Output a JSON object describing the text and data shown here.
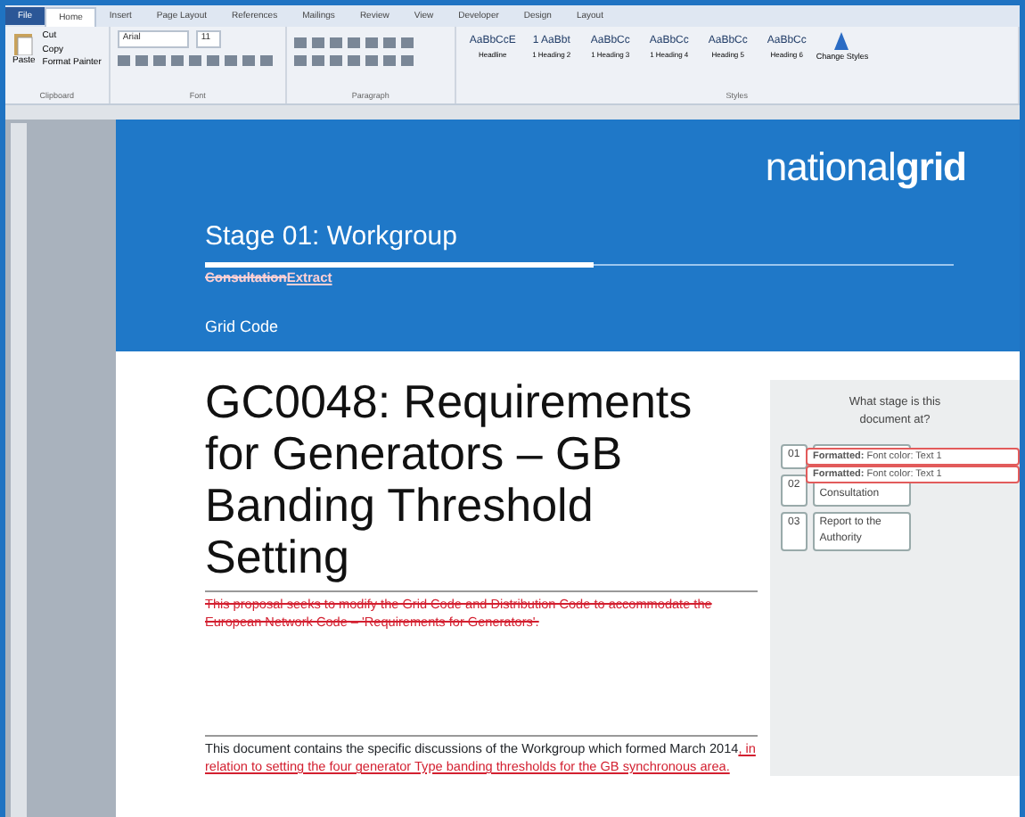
{
  "ribbon": {
    "tabs": [
      {
        "label": "File",
        "selected": false,
        "kind": "file"
      },
      {
        "label": "Home",
        "selected": true
      },
      {
        "label": "Insert",
        "selected": false
      },
      {
        "label": "Page Layout",
        "selected": false
      },
      {
        "label": "References",
        "selected": false
      },
      {
        "label": "Mailings",
        "selected": false
      },
      {
        "label": "Review",
        "selected": false
      },
      {
        "label": "View",
        "selected": false
      },
      {
        "label": "Developer",
        "selected": false
      },
      {
        "label": "Design",
        "selected": false
      },
      {
        "label": "Layout",
        "selected": false
      }
    ],
    "clipboard": {
      "paste": "Paste",
      "items": [
        "Cut",
        "Copy",
        "Format Painter"
      ],
      "label": "Clipboard"
    },
    "font": {
      "name": "Arial",
      "size": "11",
      "label": "Font"
    },
    "paragraph": {
      "label": "Paragraph"
    },
    "styles": {
      "label": "Styles",
      "items": [
        {
          "preview": "AaBbCcE",
          "name": "Headline"
        },
        {
          "preview": "1 AaBbt",
          "name": "1 Heading 2"
        },
        {
          "preview": "AaBbCc",
          "name": "1 Heading 3"
        },
        {
          "preview": "AaBbCc",
          "name": "1 Heading 4"
        },
        {
          "preview": "AaBbCc",
          "name": "Heading 5"
        },
        {
          "preview": "AaBbCc",
          "name": "Heading 6"
        }
      ],
      "change": "Change Styles"
    }
  },
  "document": {
    "logo": {
      "plain": "national",
      "bold": "grid"
    },
    "stage": "Stage 01: Workgroup",
    "stage_bar": {
      "level": 0.52
    },
    "tracked": [
      {
        "text": "Consultation",
        "kind": "deleted"
      },
      {
        "text": "Extract",
        "kind": "inserted"
      }
    ],
    "code": "Grid Code",
    "title": "GC0048: Requirements for Generators – GB Banding Threshold Setting",
    "sidebar": {
      "question": "What stage is this document at?",
      "stages": [
        {
          "number": "01"
        },
        {
          "number": "02",
          "label": "Consultation"
        },
        {
          "number": "03",
          "label": "Report to the Authority"
        }
      ]
    },
    "comments": [
      {
        "bold": "Formatted:",
        "text": "Font color: Text 1"
      },
      {
        "bold": "Formatted:",
        "text": "Font color: Text 1"
      }
    ],
    "paragraphs": [
      [
        {
          "text": "This proposal seeks to modify the Grid Code and Distribution Code to accommodate the European Network Code – 'Requirements for Generators'.",
          "kind": "deleted"
        }
      ],
      [
        {
          "text": "This document contains the specific discussions of the Workgroup which formed March 2014",
          "kind": "plain"
        },
        {
          "text": ", in relation to setting the four generator Type banding thresholds for the GB synchronous area.",
          "kind": "inserted"
        }
      ]
    ]
  }
}
